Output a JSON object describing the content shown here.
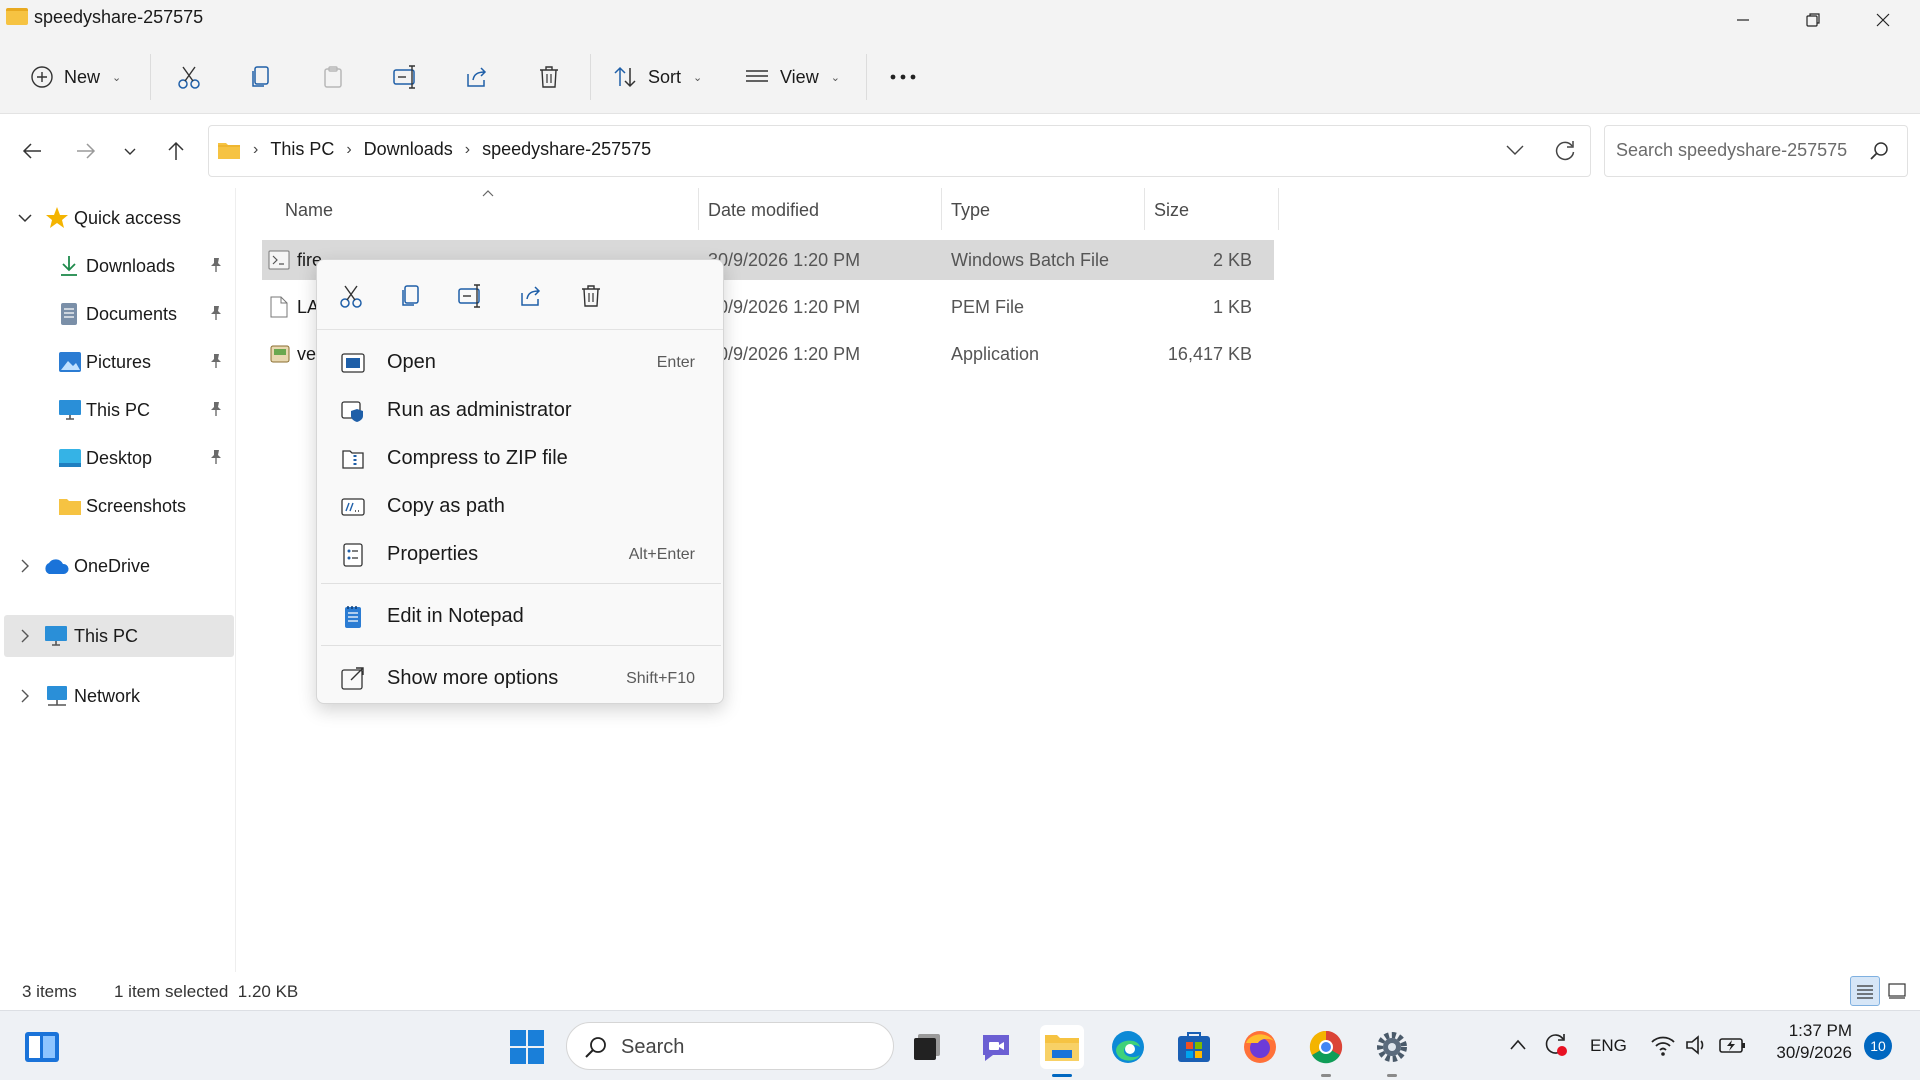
{
  "window": {
    "title": "speedyshare-257575",
    "controls": [
      "minimize",
      "maximize",
      "close"
    ]
  },
  "toolbar": {
    "new_label": "New",
    "sort_label": "Sort",
    "view_label": "View",
    "more_label": "•••"
  },
  "address": {
    "breadcrumbs": [
      "This PC",
      "Downloads",
      "speedyshare-257575"
    ],
    "search_placeholder": "Search speedyshare-257575"
  },
  "sidebar": {
    "quick_access": "Quick access",
    "items": [
      {
        "label": "Downloads",
        "icon": "download-icon",
        "pinned": true
      },
      {
        "label": "Documents",
        "icon": "documents-icon",
        "pinned": true
      },
      {
        "label": "Pictures",
        "icon": "pictures-icon",
        "pinned": true
      },
      {
        "label": "This PC",
        "icon": "monitor-icon",
        "pinned": true
      },
      {
        "label": "Desktop",
        "icon": "desktop-icon",
        "pinned": true
      },
      {
        "label": "Screenshots",
        "icon": "folder-icon",
        "pinned": false
      }
    ],
    "onedrive": "OneDrive",
    "this_pc": "This PC",
    "network": "Network"
  },
  "columns": {
    "name": "Name",
    "date": "Date modified",
    "type": "Type",
    "size": "Size"
  },
  "files": [
    {
      "name": "fire...",
      "date": "30/9/2026 1:20 PM",
      "type": "Windows Batch File",
      "size": "2 KB",
      "selected": true
    },
    {
      "name": "LA",
      "date": "30/9/2026 1:20 PM",
      "type": "PEM File",
      "size": "1 KB",
      "selected": false
    },
    {
      "name": "ve",
      "date": "30/9/2026 1:20 PM",
      "type": "Application",
      "size": "16,417 KB",
      "selected": false
    }
  ],
  "context_menu": {
    "quick_actions": [
      "cut",
      "copy",
      "rename",
      "share",
      "delete"
    ],
    "items": [
      {
        "label": "Open",
        "shortcut": "Enter",
        "icon": "open-icon"
      },
      {
        "label": "Run as administrator",
        "shortcut": "",
        "icon": "shield-icon"
      },
      {
        "label": "Compress to ZIP file",
        "shortcut": "",
        "icon": "zip-icon"
      },
      {
        "label": "Copy as path",
        "shortcut": "",
        "icon": "path-icon"
      },
      {
        "label": "Properties",
        "shortcut": "Alt+Enter",
        "icon": "properties-icon"
      },
      {
        "label": "Edit in Notepad",
        "shortcut": "",
        "icon": "notepad-icon"
      },
      {
        "label": "Show more options",
        "shortcut": "Shift+F10",
        "icon": "more-options-icon"
      }
    ]
  },
  "status": {
    "item_count": "3 items",
    "selection": "1 item selected  1.20 KB"
  },
  "taskbar": {
    "search_label": "Search",
    "language": "ENG",
    "time": "1:37 PM",
    "date": "30/9/2026",
    "notification_count": "10"
  },
  "colors": {
    "accent": "#0067c0",
    "folder": "#f6c342",
    "selection": "#d9d9d9"
  }
}
